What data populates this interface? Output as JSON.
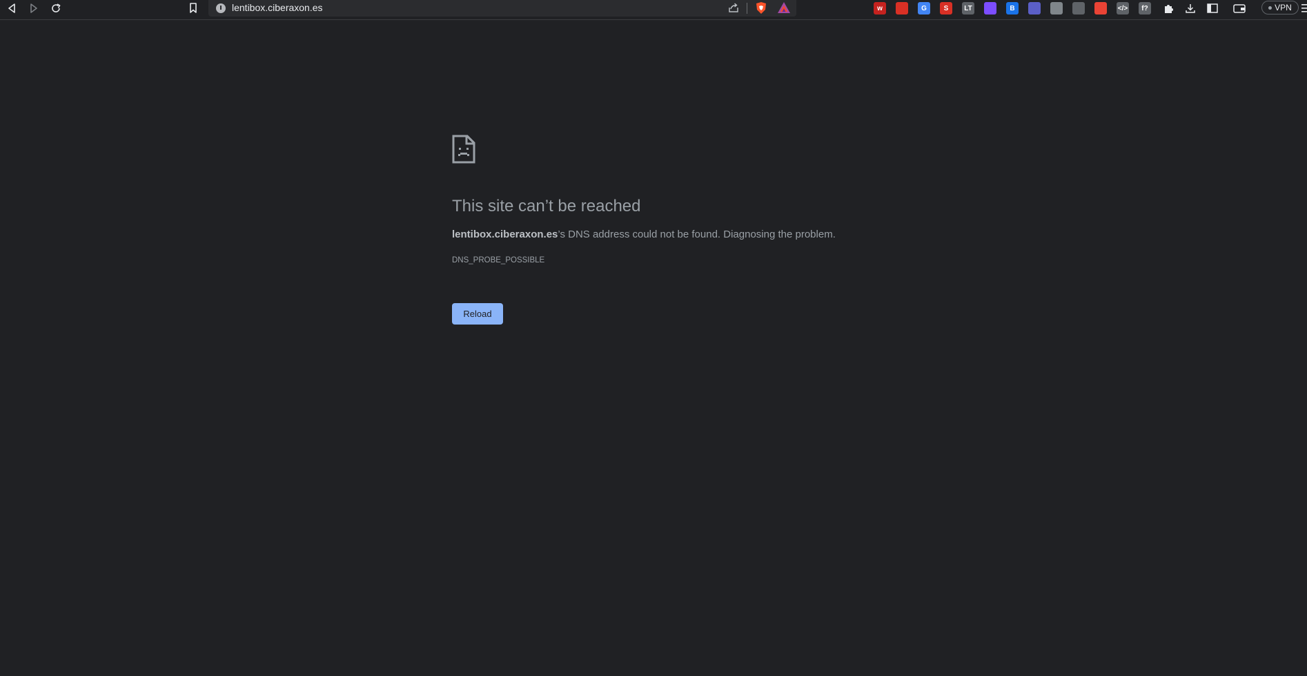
{
  "browser": {
    "url": "lentibox.ciberaxon.es",
    "vpn_label": "VPN",
    "extensions": [
      {
        "name": "ext-w-icon",
        "glyph": "w",
        "color": "#c5221f"
      },
      {
        "name": "ext-shield-icon",
        "glyph": "",
        "color": "#d93025"
      },
      {
        "name": "ext-translate-icon",
        "glyph": "G",
        "color": "#4285f4"
      },
      {
        "name": "ext-s-icon",
        "glyph": "S",
        "color": "#d93025"
      },
      {
        "name": "ext-lt-icon",
        "glyph": "LT",
        "color": "#5f6368"
      },
      {
        "name": "ext-ring-icon",
        "glyph": "",
        "color": "#7c4dff"
      },
      {
        "name": "ext-b-icon",
        "glyph": "B",
        "color": "#1a73e8"
      },
      {
        "name": "ext-gear-icon",
        "glyph": "",
        "color": "#5b5fc7"
      },
      {
        "name": "ext-database-icon",
        "glyph": "",
        "color": "#80868b"
      },
      {
        "name": "ext-circle-icon",
        "glyph": "",
        "color": "#5f6368"
      },
      {
        "name": "ext-grid-icon",
        "glyph": "",
        "color": "#ea4335"
      },
      {
        "name": "ext-code-icon",
        "glyph": "</>",
        "color": "#5f6368"
      },
      {
        "name": "ext-font-icon",
        "glyph": "f?",
        "color": "#5f6368"
      }
    ]
  },
  "error": {
    "title": "This site can’t be reached",
    "host": "lentibox.ciberaxon.es",
    "message": "’s DNS address could not be found. Diagnosing the problem.",
    "code": "DNS_PROBE_POSSIBLE",
    "reload_label": "Reload"
  }
}
